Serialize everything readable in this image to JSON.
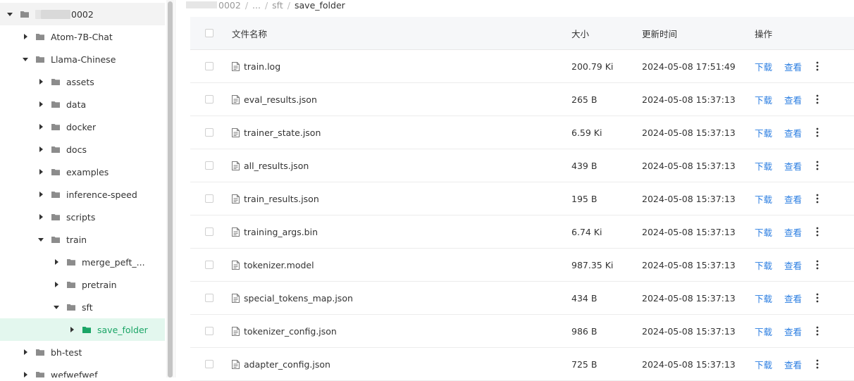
{
  "tree": {
    "root_suffix": "0002",
    "items": [
      {
        "label": "Atom-7B-Chat"
      },
      {
        "label": "Llama-Chinese"
      },
      {
        "label": "assets"
      },
      {
        "label": "data"
      },
      {
        "label": "docker"
      },
      {
        "label": "docs"
      },
      {
        "label": "examples"
      },
      {
        "label": "inference-speed"
      },
      {
        "label": "scripts"
      },
      {
        "label": "train"
      },
      {
        "label": "merge_peft_..."
      },
      {
        "label": "pretrain"
      },
      {
        "label": "sft"
      },
      {
        "label": "save_folder"
      },
      {
        "label": "bh-test"
      },
      {
        "label": "wefwefwef"
      }
    ]
  },
  "breadcrumb": {
    "root_suffix": "0002",
    "ellipsis": "...",
    "seg_sft": "sft",
    "current": "save_folder"
  },
  "table": {
    "headers": {
      "name": "文件名称",
      "size": "大小",
      "time": "更新时间",
      "ops": "操作"
    },
    "action_download": "下载",
    "action_view": "查看",
    "rows": [
      {
        "name": "train.log",
        "size": "200.79 Ki",
        "time": "2024-05-08 17:51:49"
      },
      {
        "name": "eval_results.json",
        "size": "265 B",
        "time": "2024-05-08 15:37:13"
      },
      {
        "name": "trainer_state.json",
        "size": "6.59 Ki",
        "time": "2024-05-08 15:37:13"
      },
      {
        "name": "all_results.json",
        "size": "439 B",
        "time": "2024-05-08 15:37:13"
      },
      {
        "name": "train_results.json",
        "size": "195 B",
        "time": "2024-05-08 15:37:13"
      },
      {
        "name": "training_args.bin",
        "size": "6.74 Ki",
        "time": "2024-05-08 15:37:13"
      },
      {
        "name": "tokenizer.model",
        "size": "987.35 Ki",
        "time": "2024-05-08 15:37:13"
      },
      {
        "name": "special_tokens_map.json",
        "size": "434 B",
        "time": "2024-05-08 15:37:13"
      },
      {
        "name": "tokenizer_config.json",
        "size": "986 B",
        "time": "2024-05-08 15:37:13"
      },
      {
        "name": "adapter_config.json",
        "size": "725 B",
        "time": "2024-05-08 15:37:13"
      }
    ]
  },
  "colors": {
    "accent_green": "#1aa566",
    "selected_bg": "#e3f7ee",
    "link_blue": "#2a7de1"
  }
}
